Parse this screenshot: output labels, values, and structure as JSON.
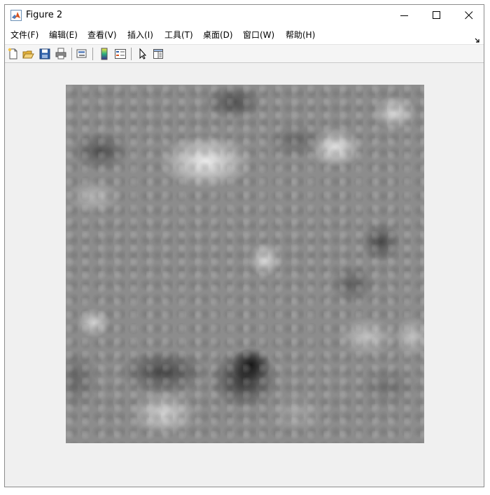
{
  "window": {
    "title": "Figure 2"
  },
  "menubar": {
    "items": [
      {
        "label": "文件(F)"
      },
      {
        "label": "编辑(E)"
      },
      {
        "label": "查看(V)"
      },
      {
        "label": "插入(I)"
      },
      {
        "label": "工具(T)"
      },
      {
        "label": "桌面(D)"
      },
      {
        "label": "窗口(W)"
      },
      {
        "label": "帮助(H)"
      }
    ]
  },
  "toolbar": {
    "buttons": [
      {
        "icon": "new-figure-icon"
      },
      {
        "icon": "open-file-icon"
      },
      {
        "icon": "save-icon"
      },
      {
        "icon": "print-icon"
      },
      {
        "icon": "link-plot-icon"
      },
      {
        "icon": "colorbar-icon"
      },
      {
        "icon": "legend-icon"
      },
      {
        "icon": "edit-plot-arrow-icon"
      },
      {
        "icon": "property-inspector-icon"
      }
    ]
  },
  "figure": {
    "content": "grayscale-noise-image",
    "colormap": "gray",
    "colors": {
      "dark": "#111111",
      "mid": "#8c8c8c",
      "light": "#f0f0f0"
    }
  }
}
